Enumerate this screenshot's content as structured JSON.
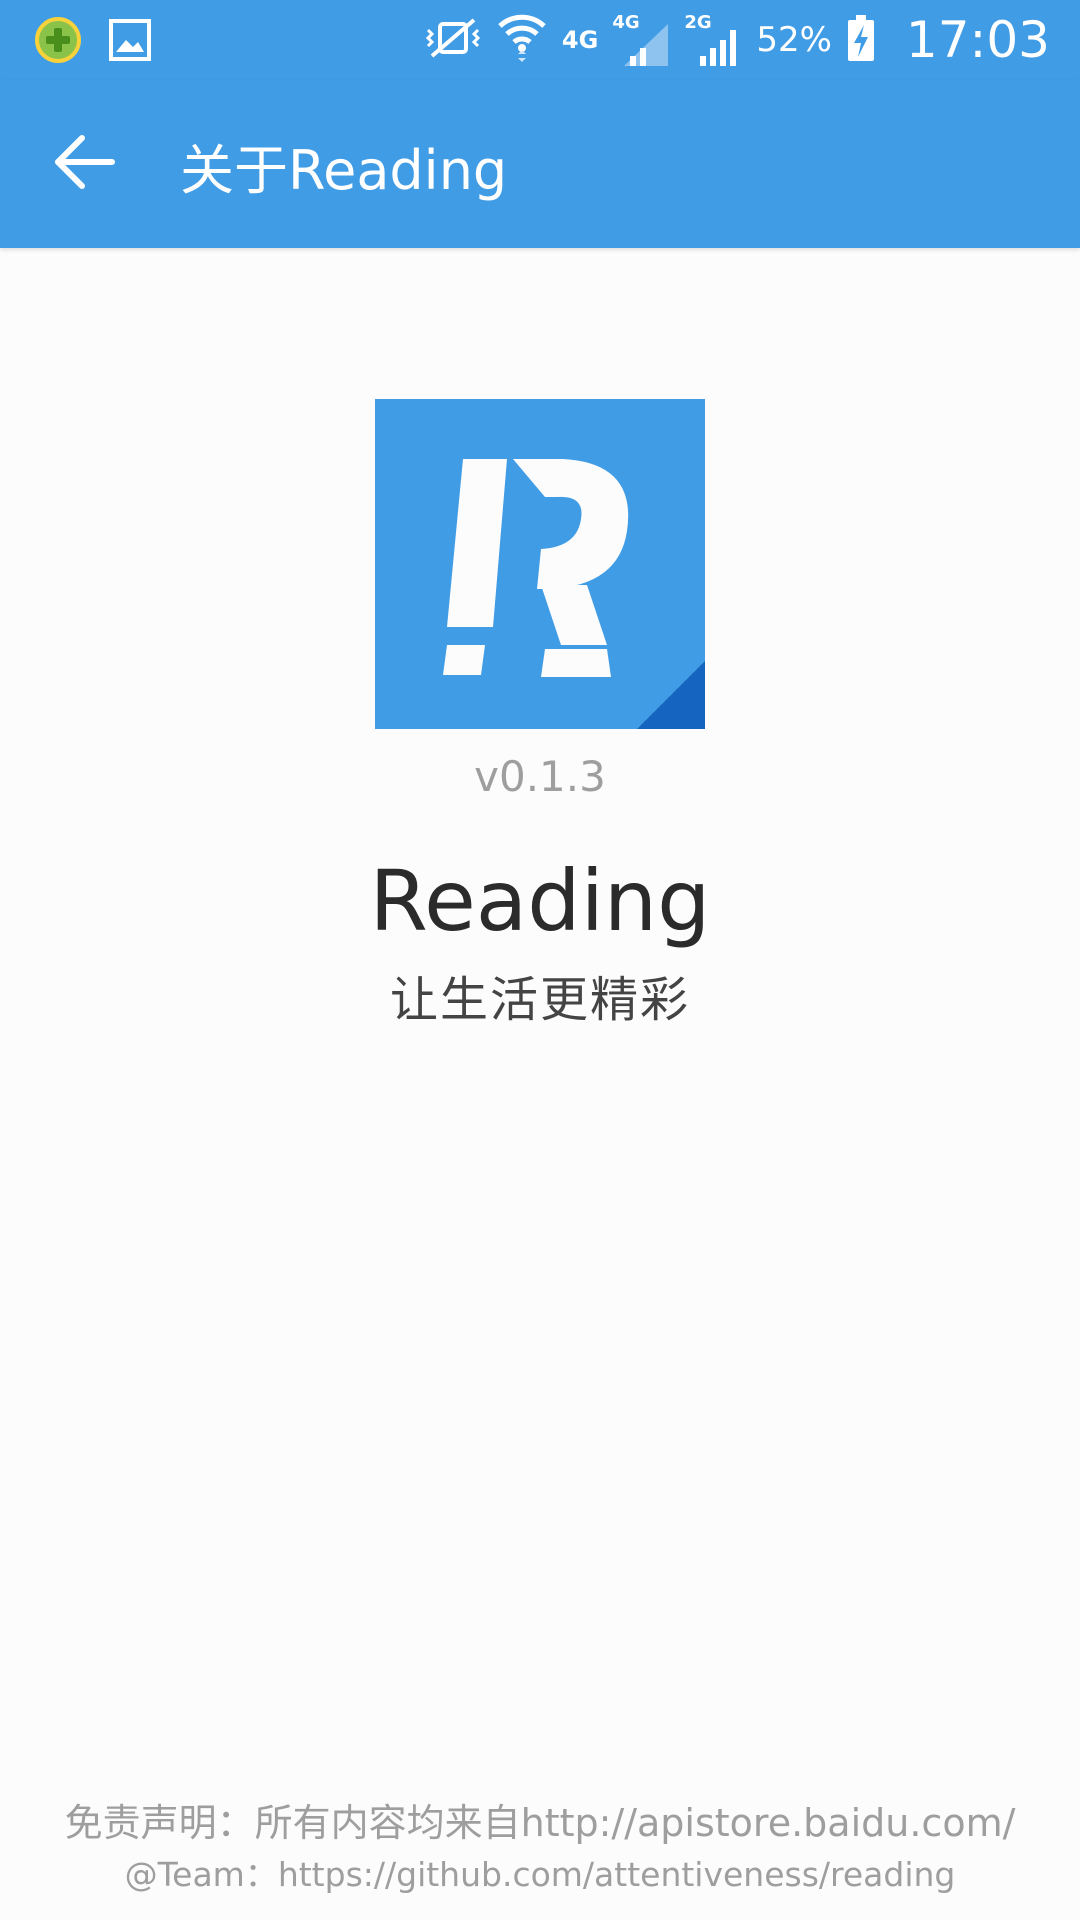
{
  "status_bar": {
    "battery": "52%",
    "clock": "17:03",
    "net_4g": "4G",
    "sim1_tag": "4G",
    "sim2_tag": "2G",
    "icons": [
      "app-notification-icon",
      "image-notification-icon",
      "vibrate-icon",
      "wifi-icon",
      "signal-icon",
      "battery-charging-icon"
    ]
  },
  "app_bar": {
    "title": "关于Reading",
    "back_icon": "arrow-back-icon"
  },
  "about": {
    "logo_icon": "reading-logo",
    "version": "v0.1.3",
    "app_name": "Reading",
    "slogan": "让生活更精彩"
  },
  "footer": {
    "disclaimer": "免责声明：所有内容均来自http://apistore.baidu.com/",
    "team": "@Team：https://github.com/attentiveness/reading"
  },
  "colors": {
    "primary": "#419ce6",
    "background": "#fcfcfc",
    "secondary_text": "#9e9e9e",
    "primary_text": "#2b2b2b"
  }
}
